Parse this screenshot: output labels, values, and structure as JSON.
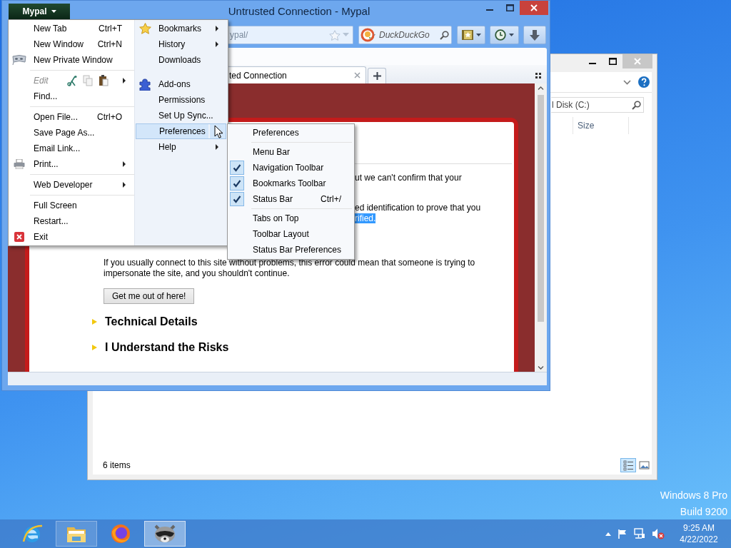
{
  "desktop": {
    "edition": "Windows 8 Pro",
    "build": "Build 9200"
  },
  "explorer": {
    "search_placeholder": "l Disk (C:)",
    "columns": [
      "Size"
    ],
    "status": "6 items",
    "views": [
      {
        "kind": "details",
        "selected": true
      },
      {
        "kind": "thumbnails",
        "selected": false
      }
    ]
  },
  "browser": {
    "title": "Untrusted Connection - Mypal",
    "menu_button": "Mypal",
    "address": "ypal/",
    "search_placeholder": "DuckDuckGo",
    "tabs": [
      {
        "label": "ted Connection",
        "selected": true
      }
    ],
    "page": {
      "lines": [
        {
          "text": "ut we can't confirm that your",
          "highlighted": false
        },
        {
          "text": "ed identification to prove that you",
          "highlighted": false
        },
        {
          "text": "rified.",
          "highlighted": true
        }
      ],
      "paragraph": "If you usually connect to this site without problems, this error could mean that someone is trying to impersonate the site, and you shouldn't continue.",
      "button": "Get me out of here!",
      "sections": [
        {
          "label": "Technical Details",
          "expanded": false
        },
        {
          "label": "I Understand the Risks",
          "expanded": false
        }
      ]
    }
  },
  "app_menu": {
    "left": [
      {
        "kind": "plain",
        "label": "New Tab",
        "shortcut": "Ctrl+T",
        "submenu": false,
        "disabled": false,
        "selected": false
      },
      {
        "kind": "plain",
        "label": "New Window",
        "shortcut": "Ctrl+N",
        "submenu": false,
        "disabled": false,
        "selected": false
      },
      {
        "kind": "private",
        "label": "New Private Window",
        "submenu": false,
        "disabled": false,
        "selected": false
      },
      {
        "kind": "separator"
      },
      {
        "kind": "edit",
        "label": "Edit",
        "submenu": true,
        "disabled": true,
        "selected": false
      },
      {
        "kind": "plain",
        "label": "Find...",
        "submenu": false,
        "disabled": false,
        "selected": false
      },
      {
        "kind": "separator"
      },
      {
        "kind": "plain",
        "label": "Open File...",
        "shortcut": "Ctrl+O",
        "submenu": false,
        "disabled": false,
        "selected": false
      },
      {
        "kind": "plain",
        "label": "Save Page As...",
        "submenu": false,
        "disabled": false,
        "selected": false
      },
      {
        "kind": "plain",
        "label": "Email Link...",
        "submenu": false,
        "disabled": false,
        "selected": false
      },
      {
        "kind": "print",
        "label": "Print...",
        "submenu": true,
        "disabled": false,
        "selected": false
      },
      {
        "kind": "separator"
      },
      {
        "kind": "plain",
        "label": "Web Developer",
        "submenu": true,
        "disabled": false,
        "selected": false
      },
      {
        "kind": "separator"
      },
      {
        "kind": "plain",
        "label": "Full Screen",
        "submenu": false,
        "disabled": false,
        "selected": false
      },
      {
        "kind": "plain",
        "label": "Restart...",
        "submenu": false,
        "disabled": false,
        "selected": false
      },
      {
        "kind": "exit",
        "label": "Exit",
        "submenu": false,
        "disabled": false,
        "selected": false
      }
    ],
    "right": [
      {
        "kind": "star",
        "label": "Bookmarks",
        "submenu": true,
        "disabled": false,
        "selected": false
      },
      {
        "kind": "plain",
        "label": "History",
        "submenu": true,
        "disabled": false,
        "selected": false
      },
      {
        "kind": "plain",
        "label": "Downloads",
        "submenu": false,
        "disabled": false,
        "selected": false
      },
      {
        "kind": "spacer"
      },
      {
        "kind": "puzzle",
        "label": "Add-ons",
        "submenu": false,
        "disabled": false,
        "selected": false
      },
      {
        "kind": "plain",
        "label": "Permissions",
        "submenu": false,
        "disabled": false,
        "selected": false
      },
      {
        "kind": "plain",
        "label": "Set Up Sync...",
        "submenu": false,
        "disabled": false,
        "selected": false
      },
      {
        "kind": "plain",
        "label": "Preferences",
        "submenu": true,
        "disabled": false,
        "selected": true
      },
      {
        "kind": "plain",
        "label": "Help",
        "submenu": true,
        "disabled": false,
        "selected": false
      }
    ]
  },
  "submenu": {
    "items": [
      {
        "kind": "item",
        "label": "Preferences",
        "checked": false
      },
      {
        "kind": "separator"
      },
      {
        "kind": "item",
        "label": "Menu Bar",
        "checked": false
      },
      {
        "kind": "item",
        "label": "Navigation Toolbar",
        "checked": true
      },
      {
        "kind": "item",
        "label": "Bookmarks Toolbar",
        "checked": true
      },
      {
        "kind": "item",
        "label": "Status Bar",
        "shortcut": "Ctrl+/",
        "checked": true
      },
      {
        "kind": "separator"
      },
      {
        "kind": "item",
        "label": "Tabs on Top",
        "checked": false
      },
      {
        "kind": "item",
        "label": "Toolbar Layout",
        "checked": false
      },
      {
        "kind": "item",
        "label": "Status Bar Preferences",
        "checked": false
      }
    ]
  },
  "taskbar": {
    "apps": [
      {
        "kind": "ie",
        "running": false,
        "selected": false
      },
      {
        "kind": "folder",
        "running": true,
        "selected": false
      },
      {
        "kind": "fox",
        "running": false,
        "selected": false
      },
      {
        "kind": "raccoon",
        "running": true,
        "selected": true
      }
    ],
    "time": "9:25 AM",
    "date": "4/22/2022"
  }
}
